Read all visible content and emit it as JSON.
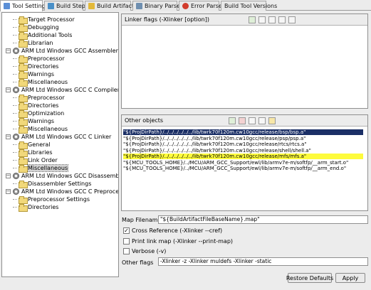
{
  "tabs": [
    {
      "label": "Tool Settings",
      "icon": "tool-settings-icon",
      "color": "#5b8fd6",
      "active": true
    },
    {
      "label": "Build Steps",
      "icon": "build-steps-icon",
      "color": "#4a90c8",
      "active": false
    },
    {
      "label": "Build Artifact",
      "icon": "build-artifact-icon",
      "color": "#e3b93a",
      "active": false
    },
    {
      "label": "Binary Parsers",
      "icon": "binary-parsers-icon",
      "color": "#6f8fb0",
      "active": false
    },
    {
      "label": "Error Parsers",
      "icon": "error-parsers-icon",
      "color": "#d23c2c",
      "active": false
    },
    {
      "label": "Build Tool Versions",
      "icon": "",
      "color": "",
      "active": false
    }
  ],
  "tree": [
    {
      "label": "Target Processor",
      "kind": "folder",
      "level": 1
    },
    {
      "label": "Debugging",
      "kind": "folder",
      "level": 1
    },
    {
      "label": "Additional Tools",
      "kind": "folder",
      "level": 1
    },
    {
      "label": "Librarian",
      "kind": "folder",
      "level": 1
    },
    {
      "label": "ARM Ltd Windows GCC Assembler",
      "kind": "tool",
      "level": 0,
      "expanded": true
    },
    {
      "label": "Preprocessor",
      "kind": "folder",
      "level": 1
    },
    {
      "label": "Directories",
      "kind": "folder",
      "level": 1
    },
    {
      "label": "Warnings",
      "kind": "folder",
      "level": 1
    },
    {
      "label": "Miscellaneous",
      "kind": "folder",
      "level": 1
    },
    {
      "label": "ARM Ltd Windows GCC C Compiler",
      "kind": "tool",
      "level": 0,
      "expanded": true
    },
    {
      "label": "Preprocessor",
      "kind": "folder",
      "level": 1
    },
    {
      "label": "Directories",
      "kind": "folder",
      "level": 1
    },
    {
      "label": "Optimization",
      "kind": "folder",
      "level": 1
    },
    {
      "label": "Warnings",
      "kind": "folder",
      "level": 1
    },
    {
      "label": "Miscellaneous",
      "kind": "folder",
      "level": 1
    },
    {
      "label": "ARM Ltd Windows GCC C Linker",
      "kind": "tool",
      "level": 0,
      "expanded": true
    },
    {
      "label": "General",
      "kind": "folder",
      "level": 1
    },
    {
      "label": "Libraries",
      "kind": "folder",
      "level": 1
    },
    {
      "label": "Link Order",
      "kind": "folder",
      "level": 1
    },
    {
      "label": "Miscellaneous",
      "kind": "folder",
      "level": 1,
      "selected": true
    },
    {
      "label": "ARM Ltd Windows GCC Disassembler",
      "kind": "tool",
      "level": 0,
      "expanded": true
    },
    {
      "label": "Disassembler Settings",
      "kind": "folder",
      "level": 1
    },
    {
      "label": "ARM Ltd Windows GCC C Preprocessor",
      "kind": "tool",
      "level": 0,
      "expanded": true
    },
    {
      "label": "Preprocessor Settings",
      "kind": "folder",
      "level": 1
    },
    {
      "label": "Directories",
      "kind": "folder",
      "level": 1
    }
  ],
  "linker_flags": {
    "title": "Linker flags (-Xlinker [option])"
  },
  "other_objects": {
    "title": "Other objects",
    "rows": [
      {
        "text": "\"${ProjDirPath}/../../../../../../lib/twrk70f120m.cw10gcc/release/bsp/bsp.a\"",
        "state": "selected"
      },
      {
        "text": "\"${ProjDirPath}/../../../../../../lib/twrk70f120m.cw10gcc/release/psp/psp.a\"",
        "state": "normal"
      },
      {
        "text": "\"${ProjDirPath}/../../../../../../lib/twrk70f120m.cw10gcc/release/rtcs/rtcs.a\"",
        "state": "normal"
      },
      {
        "text": "\"${ProjDirPath}/../../../../../../lib/twrk70f120m.cw10gcc/release/shell/shell.a\"",
        "state": "normal"
      },
      {
        "text": "\"${ProjDirPath}/../../../../../../lib/twrk70f120m.cw10gcc/release/mfs/mfs.a\"",
        "state": "highlight"
      },
      {
        "text": "\"${MCU_TOOLS_HOME}/../MCU/ARM_GCC_Support/ewl/lib/armv7e-m/softfp/__arm_start.o\"",
        "state": "normal"
      },
      {
        "text": "\"${MCU_TOOLS_HOME}/../MCU/ARM_GCC_Support/ewl/lib/armv7e-m/softfp/__arm_end.o\"",
        "state": "normal"
      }
    ]
  },
  "map_filename": {
    "label": "Map Filename",
    "value": "\"${BuildArtifactFileBaseName}.map\""
  },
  "options": [
    {
      "label": "Cross Reference (-Xlinker --cref)",
      "checked": true
    },
    {
      "label": "Print link map (-Xlinker --print-map)",
      "checked": false
    },
    {
      "label": "Verbose (-v)",
      "checked": false
    }
  ],
  "other_flags": {
    "label": "Other flags",
    "value": "-Xlinker -z -Xlinker muldefs   -Xlinker -static"
  },
  "buttons": {
    "restore": "Restore Defaults",
    "apply": "Apply"
  },
  "colors": {
    "selection": "#1b2f66",
    "highlight": "#fdfb3c",
    "tree_selection": "#d5d5d5"
  }
}
